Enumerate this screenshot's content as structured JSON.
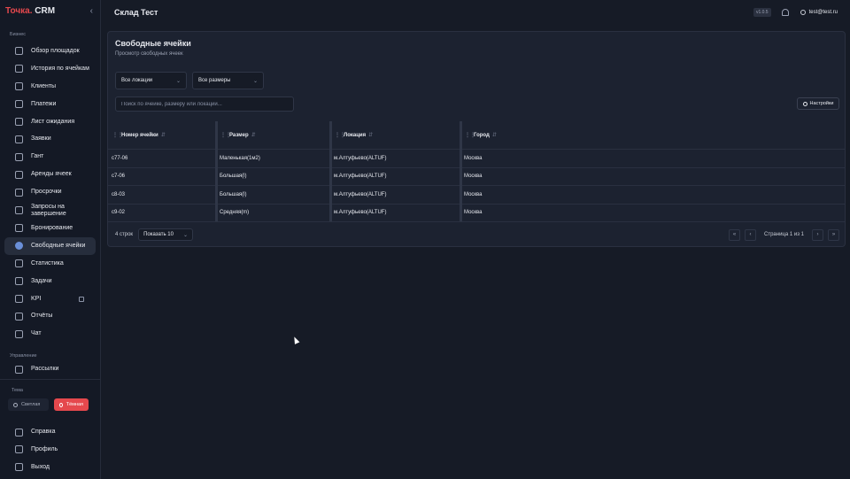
{
  "app": {
    "logo_brand": "Точка.",
    "logo_name": "CRM"
  },
  "sidebar": {
    "section_business": "Бизнес",
    "items": [
      {
        "label": "Обзор площадок",
        "icon": "building-icon"
      },
      {
        "label": "История по ячейкам",
        "icon": "history-icon"
      },
      {
        "label": "Клиенты",
        "icon": "users-icon"
      },
      {
        "label": "Платежи",
        "icon": "card-icon"
      },
      {
        "label": "Лист ожидания",
        "icon": "clipboard-icon"
      },
      {
        "label": "Заявки",
        "icon": "requests-icon"
      },
      {
        "label": "Гант",
        "icon": "calendar-icon"
      },
      {
        "label": "Аренды ячеек",
        "icon": "box-icon"
      },
      {
        "label": "Просрочки",
        "icon": "warning-icon"
      },
      {
        "label": "Запросы на завершение",
        "icon": "copy-icon"
      },
      {
        "label": "Бронирование",
        "icon": "bookmark-icon"
      },
      {
        "label": "Свободные ячейки",
        "icon": "check-circle-icon"
      },
      {
        "label": "Статистика",
        "icon": "chart-icon"
      },
      {
        "label": "Задачи",
        "icon": "target-icon"
      },
      {
        "label": "KPI",
        "icon": "kpi-icon"
      },
      {
        "label": "Отчёты",
        "icon": "report-icon"
      },
      {
        "label": "Чат",
        "icon": "chat-icon"
      }
    ],
    "section_management": "Управление",
    "management_items": [
      {
        "label": "Рассылки",
        "icon": "mail-icon"
      }
    ],
    "theme_label": "Тема",
    "theme_light": "Светлая",
    "theme_dark": "Тёмная",
    "bottom_items": [
      {
        "label": "Справка",
        "icon": "help-icon"
      },
      {
        "label": "Профиль",
        "icon": "profile-icon"
      },
      {
        "label": "Выход",
        "icon": "logout-icon"
      }
    ]
  },
  "topbar": {
    "title": "Склад Тест",
    "version": "v1.0.5",
    "user": "test@test.ru"
  },
  "page": {
    "title": "Свободные ячейки",
    "subtitle": "Просмотр свободных ячеек",
    "filter_location": "Все локации",
    "filter_size": "Все размеры",
    "search_placeholder": "Поиск по ячейке, размеру или локации...",
    "settings_label": "Настройки"
  },
  "table": {
    "columns": [
      "Номер ячейки",
      "Размер",
      "Локация",
      "Город"
    ],
    "rows": [
      [
        "c77-06",
        "Маленькая(1м2)",
        "м.Алтуфьево(ALTUF)",
        "Москва"
      ],
      [
        "c7-06",
        "Большая(l)",
        "м.Алтуфьево(ALTUF)",
        "Москва"
      ],
      [
        "c8-03",
        "Большая(l)",
        "м.Алтуфьево(ALTUF)",
        "Москва"
      ],
      [
        "c9-02",
        "Средняя(m)",
        "м.Алтуфьево(ALTUF)",
        "Москва"
      ]
    ]
  },
  "footer": {
    "rows_count": "4 строк",
    "page_size": "Показать 10",
    "page_info": "Страница 1 из 1"
  },
  "colors": {
    "accent": "#e5484d",
    "active_icon": "#6a8fd8",
    "background": "#161b26"
  }
}
